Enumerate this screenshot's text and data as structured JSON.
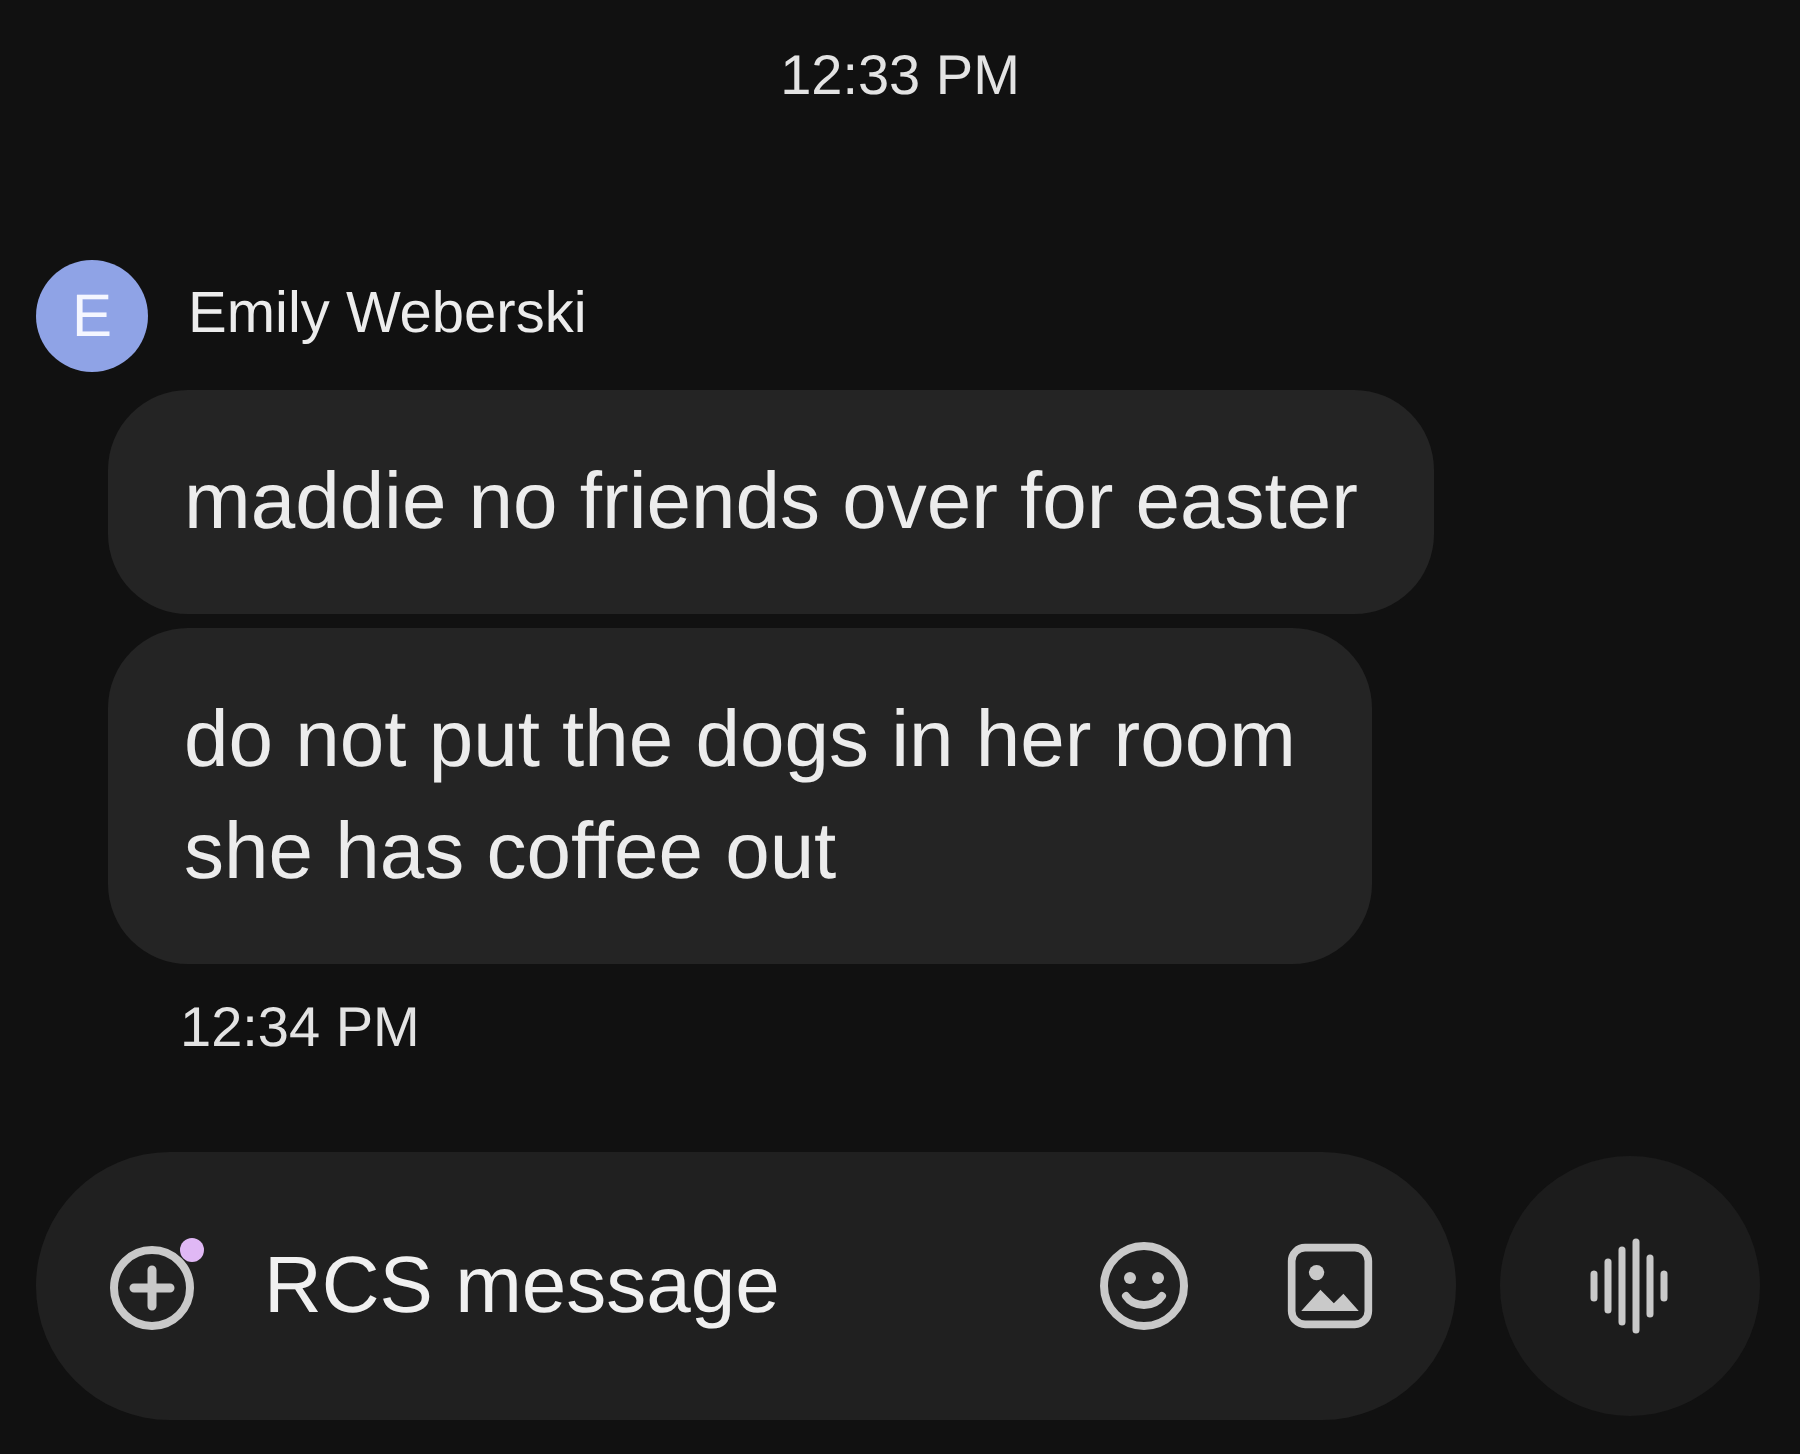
{
  "header_time": "12:33 PM",
  "sender": {
    "initial": "E",
    "name": "Emily Weberski"
  },
  "messages": [
    {
      "text": "maddie no friends over for easter"
    },
    {
      "text": "do not put the dogs in her room\nshe has coffee out"
    }
  ],
  "footer_time": "12:34 PM",
  "composer": {
    "placeholder": "RCS message",
    "attach_badge": true
  }
}
